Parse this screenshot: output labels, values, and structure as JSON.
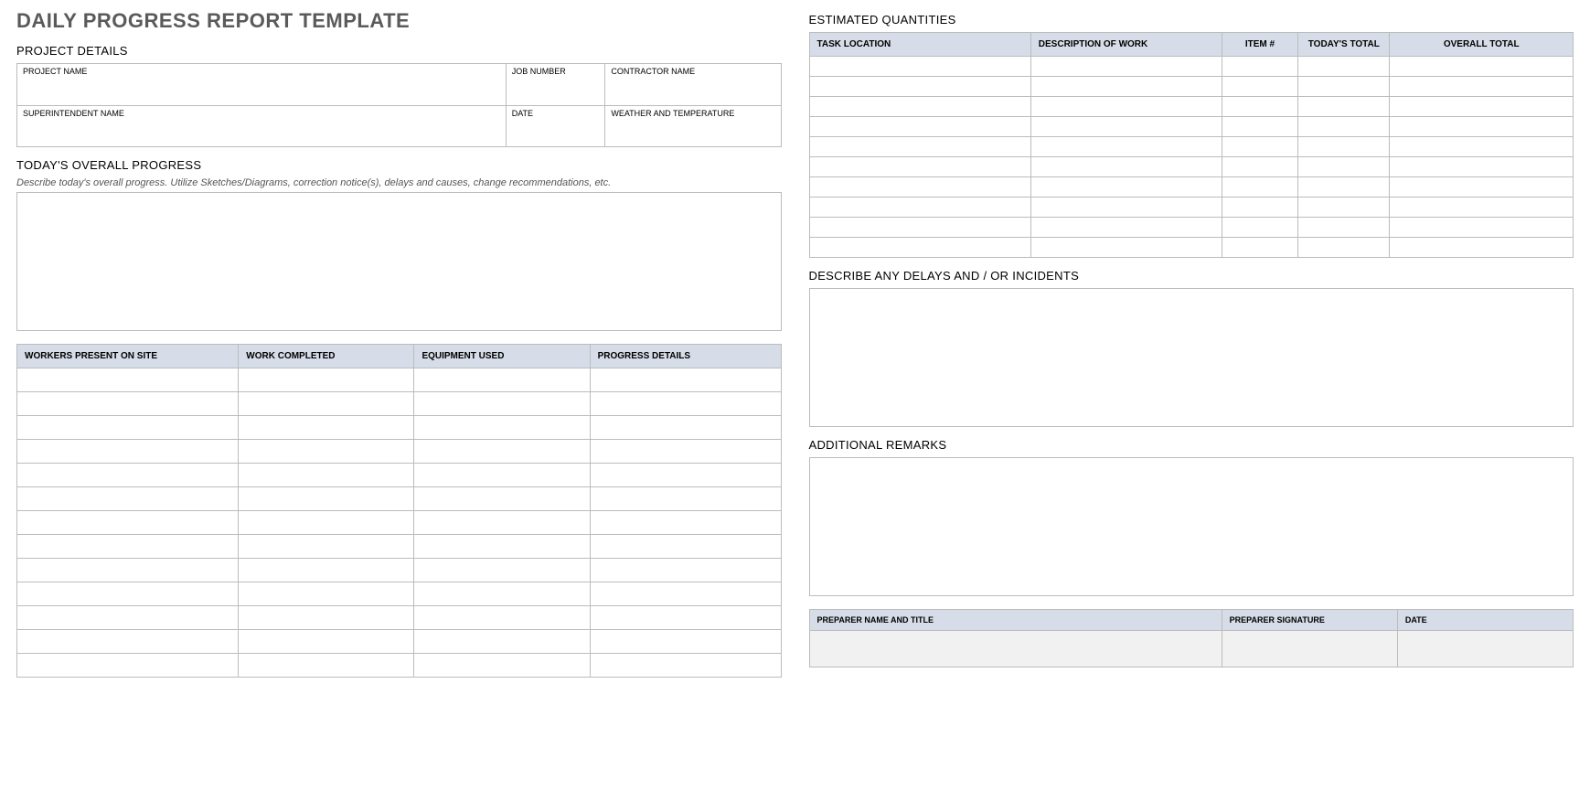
{
  "title": "DAILY PROGRESS REPORT TEMPLATE",
  "left": {
    "projectDetails": {
      "heading": "PROJECT DETAILS",
      "row1": {
        "projectName": "PROJECT NAME",
        "jobNumber": "JOB NUMBER",
        "contractorName": "CONTRACTOR NAME"
      },
      "row2": {
        "superintendentName": "SUPERINTENDENT NAME",
        "date": "DATE",
        "weather": "WEATHER AND TEMPERATURE"
      }
    },
    "overallProgress": {
      "heading": "TODAY'S OVERALL PROGRESS",
      "hint": "Describe today's overall progress.  Utilize Sketches/Diagrams, correction notice(s), delays and causes, change recommendations, etc."
    },
    "progressTable": {
      "headers": {
        "workers": "WORKERS PRESENT ON SITE",
        "workCompleted": "WORK COMPLETED",
        "equipment": "EQUIPMENT USED",
        "details": "PROGRESS DETAILS"
      }
    }
  },
  "right": {
    "estQty": {
      "heading": "ESTIMATED QUANTITIES",
      "headers": {
        "taskLocation": "TASK LOCATION",
        "descWork": "DESCRIPTION OF WORK",
        "item": "ITEM #",
        "todaysTotal": "TODAY'S TOTAL",
        "overallTotal": "OVERALL TOTAL"
      }
    },
    "delays": {
      "heading": "DESCRIBE ANY DELAYS AND / OR INCIDENTS"
    },
    "remarks": {
      "heading": "ADDITIONAL REMARKS"
    },
    "signature": {
      "preparerName": "PREPARER NAME AND TITLE",
      "preparerSig": "PREPARER SIGNATURE",
      "date": "DATE"
    }
  }
}
